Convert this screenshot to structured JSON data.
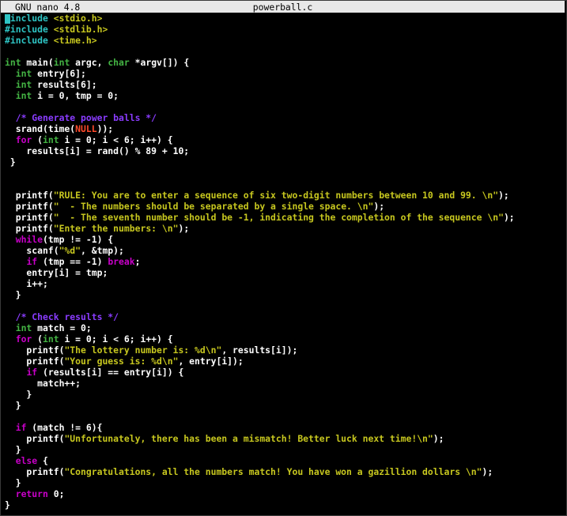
{
  "titlebar": {
    "version": "GNU nano 4.8",
    "filename": "powerball.c"
  },
  "colors": {
    "background": "#000000",
    "preprocessor": "#2ec4c4",
    "string": "#c7c71f",
    "type": "#44b544",
    "keyword": "#c800c8",
    "comment": "#8a3cff",
    "null": "#ff4a2b",
    "titlebar": "#e8e8e8"
  },
  "lines": [
    [
      [
        "pp",
        "#include "
      ],
      [
        "str",
        "<stdio.h>"
      ]
    ],
    [
      [
        "pp",
        "#include "
      ],
      [
        "str",
        "<stdlib.h>"
      ]
    ],
    [
      [
        "pp",
        "#include "
      ],
      [
        "str",
        "<time.h>"
      ]
    ],
    [],
    [
      [
        "type",
        "int"
      ],
      [
        "df",
        " main("
      ],
      [
        "type",
        "int"
      ],
      [
        "df",
        " argc, "
      ],
      [
        "type",
        "char"
      ],
      [
        "df",
        " *argv[]) {"
      ]
    ],
    [
      [
        "df",
        "  "
      ],
      [
        "type",
        "int"
      ],
      [
        "df",
        " entry[6];"
      ]
    ],
    [
      [
        "df",
        "  "
      ],
      [
        "type",
        "int"
      ],
      [
        "df",
        " results[6];"
      ]
    ],
    [
      [
        "df",
        "  "
      ],
      [
        "type",
        "int"
      ],
      [
        "df",
        " i = 0, tmp = 0;"
      ]
    ],
    [],
    [
      [
        "df",
        "  "
      ],
      [
        "cm",
        "/* Generate power balls */"
      ]
    ],
    [
      [
        "df",
        "  srand(time("
      ],
      [
        "nu",
        "NULL"
      ],
      [
        "df",
        "));"
      ]
    ],
    [
      [
        "df",
        "  "
      ],
      [
        "kw",
        "for"
      ],
      [
        "df",
        " ("
      ],
      [
        "type",
        "int"
      ],
      [
        "df",
        " i = 0; i < 6; i++) {"
      ]
    ],
    [
      [
        "df",
        "    results[i] = rand() % 89 + 10;"
      ]
    ],
    [
      [
        "df",
        " }"
      ]
    ],
    [],
    [],
    [
      [
        "df",
        "  printf("
      ],
      [
        "str",
        "\"RULE: You are to enter a sequence of six two-digit numbers between 10 and 99. \\n\""
      ],
      [
        "df",
        ");"
      ]
    ],
    [
      [
        "df",
        "  printf("
      ],
      [
        "str",
        "\"  - The numbers should be separated by a single space. \\n\""
      ],
      [
        "df",
        ");"
      ]
    ],
    [
      [
        "df",
        "  printf("
      ],
      [
        "str",
        "\"  - The seventh number should be -1, indicating the completion of the sequence \\n\""
      ],
      [
        "df",
        ");"
      ]
    ],
    [
      [
        "df",
        "  printf("
      ],
      [
        "str",
        "\"Enter the numbers: \\n\""
      ],
      [
        "df",
        ");"
      ]
    ],
    [
      [
        "df",
        "  "
      ],
      [
        "kw",
        "while"
      ],
      [
        "df",
        "(tmp != -1) {"
      ]
    ],
    [
      [
        "df",
        "    scanf("
      ],
      [
        "str",
        "\"%d\""
      ],
      [
        "df",
        ", &tmp);"
      ]
    ],
    [
      [
        "df",
        "    "
      ],
      [
        "kw",
        "if"
      ],
      [
        "df",
        " (tmp == -1) "
      ],
      [
        "kw",
        "break"
      ],
      [
        "df",
        ";"
      ]
    ],
    [
      [
        "df",
        "    entry[i] = tmp;"
      ]
    ],
    [
      [
        "df",
        "    i++;"
      ]
    ],
    [
      [
        "df",
        "  }"
      ]
    ],
    [],
    [
      [
        "df",
        "  "
      ],
      [
        "cm",
        "/* Check results */"
      ]
    ],
    [
      [
        "df",
        "  "
      ],
      [
        "type",
        "int"
      ],
      [
        "df",
        " match = 0;"
      ]
    ],
    [
      [
        "df",
        "  "
      ],
      [
        "kw",
        "for"
      ],
      [
        "df",
        " ("
      ],
      [
        "type",
        "int"
      ],
      [
        "df",
        " i = 0; i < 6; i++) {"
      ]
    ],
    [
      [
        "df",
        "    printf("
      ],
      [
        "str",
        "\"The lottery number is: %d\\n\""
      ],
      [
        "df",
        ", results[i]);"
      ]
    ],
    [
      [
        "df",
        "    printf("
      ],
      [
        "str",
        "\"Your guess is: %d\\n\""
      ],
      [
        "df",
        ", entry[i]);"
      ]
    ],
    [
      [
        "df",
        "    "
      ],
      [
        "kw",
        "if"
      ],
      [
        "df",
        " (results[i] == entry[i]) {"
      ]
    ],
    [
      [
        "df",
        "      match++;"
      ]
    ],
    [
      [
        "df",
        "    }"
      ]
    ],
    [
      [
        "df",
        "  }"
      ]
    ],
    [],
    [
      [
        "df",
        "  "
      ],
      [
        "kw",
        "if"
      ],
      [
        "df",
        " (match != 6){"
      ]
    ],
    [
      [
        "df",
        "    printf("
      ],
      [
        "str",
        "\"Unfortunately, there has been a mismatch! Better luck next time!\\n\""
      ],
      [
        "df",
        ");"
      ]
    ],
    [
      [
        "df",
        "  }"
      ]
    ],
    [
      [
        "df",
        "  "
      ],
      [
        "kw",
        "else"
      ],
      [
        "df",
        " {"
      ]
    ],
    [
      [
        "df",
        "    printf("
      ],
      [
        "str",
        "\"Congratulations, all the numbers match! You have won a gazillion dollars \\n\""
      ],
      [
        "df",
        ");"
      ]
    ],
    [
      [
        "df",
        "  }"
      ]
    ],
    [
      [
        "df",
        "  "
      ],
      [
        "kw",
        "return"
      ],
      [
        "df",
        " 0;"
      ]
    ],
    [
      [
        "df",
        "}"
      ]
    ]
  ]
}
